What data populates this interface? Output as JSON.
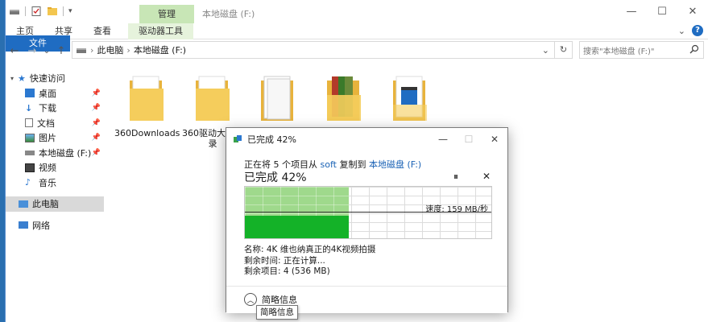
{
  "titlebar": {
    "context_tab_header": "管理",
    "title": "本地磁盘 (F:)",
    "minimize": "—",
    "maximize": "☐",
    "close": "✕"
  },
  "ribbon": {
    "tabs": [
      "文件",
      "主页",
      "共享",
      "查看",
      "驱动器工具"
    ],
    "collapse": "⌄",
    "help": "?"
  },
  "nav": {
    "back": "←",
    "forward": "→",
    "recent": "⌄",
    "up": "↑",
    "breadcrumb": [
      "此电脑",
      "本地磁盘 (F:)"
    ],
    "separator": "›",
    "refresh": "↻",
    "search_placeholder": "搜索\"本地磁盘 (F:)\""
  },
  "sidebar": {
    "quick_access": "快速访问",
    "items": [
      {
        "label": "桌面",
        "pinned": true,
        "icon": "desktop-icon"
      },
      {
        "label": "下载",
        "pinned": true,
        "icon": "download-icon"
      },
      {
        "label": "文档",
        "pinned": true,
        "icon": "document-icon"
      },
      {
        "label": "图片",
        "pinned": true,
        "icon": "picture-icon"
      },
      {
        "label": "本地磁盘 (F:)",
        "pinned": true,
        "icon": "drive-icon"
      },
      {
        "label": "视频",
        "pinned": false,
        "icon": "video-icon"
      },
      {
        "label": "音乐",
        "pinned": false,
        "icon": "music-icon"
      }
    ],
    "this_pc": "此电脑",
    "network": "网络"
  },
  "files": [
    {
      "name": "360Downloads"
    },
    {
      "name": "360驱动大师目录"
    },
    {
      "name": ""
    },
    {
      "name": ""
    },
    {
      "name": ""
    }
  ],
  "dialog": {
    "title": "已完成 42%",
    "status_prefix": "正在将 5 个项目从 ",
    "source": "soft",
    "status_mid": " 复制到 ",
    "destination": "本地磁盘 (F:)",
    "percent_label": "已完成 42%",
    "progress": 0.42,
    "speed": "速度: 159 MB/秒",
    "name_line": "名称: 4K 维也纳真正的4K视频拍摄",
    "time_line": "剩余时间: 正在计算...",
    "items_line": "剩余项目: 4 (536 MB)",
    "less_details": "简略信息",
    "pause": "⏸",
    "cancel": "✕",
    "minimize": "—",
    "maximize": "☐",
    "close": "✕"
  },
  "tooltip": "简略信息",
  "colors": {
    "accent": "#1f6cc2",
    "progress_done": "#9fd98c",
    "progress_fill": "#14b228",
    "folder": "#f3c64f"
  }
}
